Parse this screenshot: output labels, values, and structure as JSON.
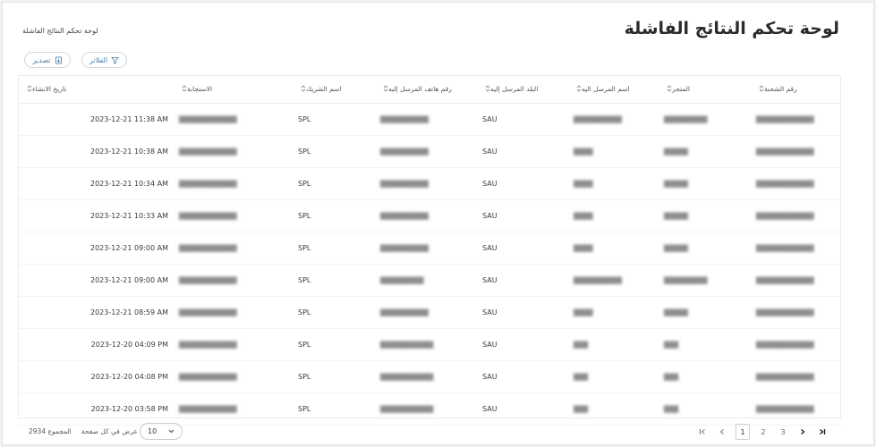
{
  "header": {
    "title": "لوحة تحكم النتائج الفاشلة",
    "breadcrumb": "لوحة تحكم النتائج الفاشلة"
  },
  "toolbar": {
    "filter_label": "الفلاتر",
    "export_label": "تصدير",
    "accent": "#4a7ea8"
  },
  "table": {
    "columns": [
      "رقم الشحنة",
      "المتجر",
      "اسم المرسل اليه",
      "البلد المرسل إليه",
      "رقم هاتف المرسل إليه",
      "اسم الشريك",
      "الاستجابة",
      "تاريخ الانشاء"
    ],
    "rows": [
      {
        "country": "SAU",
        "partner": "SPL",
        "created": "2023-12-21 11:38 AM"
      },
      {
        "country": "SAU",
        "partner": "SPL",
        "created": "2023-12-21 10:38 AM"
      },
      {
        "country": "SAU",
        "partner": "SPL",
        "created": "2023-12-21 10:34 AM"
      },
      {
        "country": "SAU",
        "partner": "SPL",
        "created": "2023-12-21 10:33 AM"
      },
      {
        "country": "SAU",
        "partner": "SPL",
        "created": "2023-12-21 09:00 AM"
      },
      {
        "country": "SAU",
        "partner": "SPL",
        "created": "2023-12-21 09:00 AM"
      },
      {
        "country": "SAU",
        "partner": "SPL",
        "created": "2023-12-21 08:59 AM"
      },
      {
        "country": "SAU",
        "partner": "SPL",
        "created": "2023-12-20 04:09 PM"
      },
      {
        "country": "SAU",
        "partner": "SPL",
        "created": "2023-12-20 04:08 PM"
      },
      {
        "country": "SAU",
        "partner": "SPL",
        "created": "2023-12-20 03:58 PM"
      }
    ]
  },
  "footer": {
    "total_label": "المجموع",
    "total_value": "2934",
    "per_page_label": "عرض في كل صفحة",
    "per_page_value": "10",
    "pages": [
      "1",
      "2",
      "3"
    ],
    "current_page": "1"
  }
}
